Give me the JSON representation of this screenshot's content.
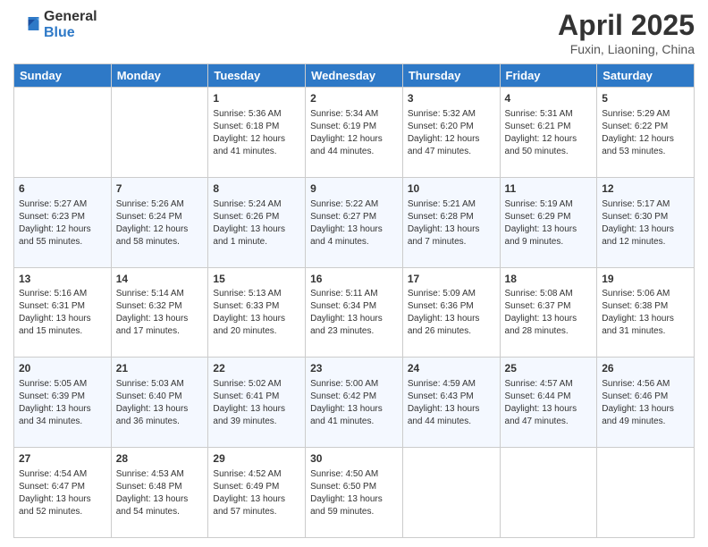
{
  "header": {
    "logo_line1": "General",
    "logo_line2": "Blue",
    "month_title": "April 2025",
    "subtitle": "Fuxin, Liaoning, China"
  },
  "days_of_week": [
    "Sunday",
    "Monday",
    "Tuesday",
    "Wednesday",
    "Thursday",
    "Friday",
    "Saturday"
  ],
  "weeks": [
    [
      {
        "day": "",
        "sunrise": "",
        "sunset": "",
        "daylight": ""
      },
      {
        "day": "",
        "sunrise": "",
        "sunset": "",
        "daylight": ""
      },
      {
        "day": "1",
        "sunrise": "Sunrise: 5:36 AM",
        "sunset": "Sunset: 6:18 PM",
        "daylight": "Daylight: 12 hours and 41 minutes."
      },
      {
        "day": "2",
        "sunrise": "Sunrise: 5:34 AM",
        "sunset": "Sunset: 6:19 PM",
        "daylight": "Daylight: 12 hours and 44 minutes."
      },
      {
        "day": "3",
        "sunrise": "Sunrise: 5:32 AM",
        "sunset": "Sunset: 6:20 PM",
        "daylight": "Daylight: 12 hours and 47 minutes."
      },
      {
        "day": "4",
        "sunrise": "Sunrise: 5:31 AM",
        "sunset": "Sunset: 6:21 PM",
        "daylight": "Daylight: 12 hours and 50 minutes."
      },
      {
        "day": "5",
        "sunrise": "Sunrise: 5:29 AM",
        "sunset": "Sunset: 6:22 PM",
        "daylight": "Daylight: 12 hours and 53 minutes."
      }
    ],
    [
      {
        "day": "6",
        "sunrise": "Sunrise: 5:27 AM",
        "sunset": "Sunset: 6:23 PM",
        "daylight": "Daylight: 12 hours and 55 minutes."
      },
      {
        "day": "7",
        "sunrise": "Sunrise: 5:26 AM",
        "sunset": "Sunset: 6:24 PM",
        "daylight": "Daylight: 12 hours and 58 minutes."
      },
      {
        "day": "8",
        "sunrise": "Sunrise: 5:24 AM",
        "sunset": "Sunset: 6:26 PM",
        "daylight": "Daylight: 13 hours and 1 minute."
      },
      {
        "day": "9",
        "sunrise": "Sunrise: 5:22 AM",
        "sunset": "Sunset: 6:27 PM",
        "daylight": "Daylight: 13 hours and 4 minutes."
      },
      {
        "day": "10",
        "sunrise": "Sunrise: 5:21 AM",
        "sunset": "Sunset: 6:28 PM",
        "daylight": "Daylight: 13 hours and 7 minutes."
      },
      {
        "day": "11",
        "sunrise": "Sunrise: 5:19 AM",
        "sunset": "Sunset: 6:29 PM",
        "daylight": "Daylight: 13 hours and 9 minutes."
      },
      {
        "day": "12",
        "sunrise": "Sunrise: 5:17 AM",
        "sunset": "Sunset: 6:30 PM",
        "daylight": "Daylight: 13 hours and 12 minutes."
      }
    ],
    [
      {
        "day": "13",
        "sunrise": "Sunrise: 5:16 AM",
        "sunset": "Sunset: 6:31 PM",
        "daylight": "Daylight: 13 hours and 15 minutes."
      },
      {
        "day": "14",
        "sunrise": "Sunrise: 5:14 AM",
        "sunset": "Sunset: 6:32 PM",
        "daylight": "Daylight: 13 hours and 17 minutes."
      },
      {
        "day": "15",
        "sunrise": "Sunrise: 5:13 AM",
        "sunset": "Sunset: 6:33 PM",
        "daylight": "Daylight: 13 hours and 20 minutes."
      },
      {
        "day": "16",
        "sunrise": "Sunrise: 5:11 AM",
        "sunset": "Sunset: 6:34 PM",
        "daylight": "Daylight: 13 hours and 23 minutes."
      },
      {
        "day": "17",
        "sunrise": "Sunrise: 5:09 AM",
        "sunset": "Sunset: 6:36 PM",
        "daylight": "Daylight: 13 hours and 26 minutes."
      },
      {
        "day": "18",
        "sunrise": "Sunrise: 5:08 AM",
        "sunset": "Sunset: 6:37 PM",
        "daylight": "Daylight: 13 hours and 28 minutes."
      },
      {
        "day": "19",
        "sunrise": "Sunrise: 5:06 AM",
        "sunset": "Sunset: 6:38 PM",
        "daylight": "Daylight: 13 hours and 31 minutes."
      }
    ],
    [
      {
        "day": "20",
        "sunrise": "Sunrise: 5:05 AM",
        "sunset": "Sunset: 6:39 PM",
        "daylight": "Daylight: 13 hours and 34 minutes."
      },
      {
        "day": "21",
        "sunrise": "Sunrise: 5:03 AM",
        "sunset": "Sunset: 6:40 PM",
        "daylight": "Daylight: 13 hours and 36 minutes."
      },
      {
        "day": "22",
        "sunrise": "Sunrise: 5:02 AM",
        "sunset": "Sunset: 6:41 PM",
        "daylight": "Daylight: 13 hours and 39 minutes."
      },
      {
        "day": "23",
        "sunrise": "Sunrise: 5:00 AM",
        "sunset": "Sunset: 6:42 PM",
        "daylight": "Daylight: 13 hours and 41 minutes."
      },
      {
        "day": "24",
        "sunrise": "Sunrise: 4:59 AM",
        "sunset": "Sunset: 6:43 PM",
        "daylight": "Daylight: 13 hours and 44 minutes."
      },
      {
        "day": "25",
        "sunrise": "Sunrise: 4:57 AM",
        "sunset": "Sunset: 6:44 PM",
        "daylight": "Daylight: 13 hours and 47 minutes."
      },
      {
        "day": "26",
        "sunrise": "Sunrise: 4:56 AM",
        "sunset": "Sunset: 6:46 PM",
        "daylight": "Daylight: 13 hours and 49 minutes."
      }
    ],
    [
      {
        "day": "27",
        "sunrise": "Sunrise: 4:54 AM",
        "sunset": "Sunset: 6:47 PM",
        "daylight": "Daylight: 13 hours and 52 minutes."
      },
      {
        "day": "28",
        "sunrise": "Sunrise: 4:53 AM",
        "sunset": "Sunset: 6:48 PM",
        "daylight": "Daylight: 13 hours and 54 minutes."
      },
      {
        "day": "29",
        "sunrise": "Sunrise: 4:52 AM",
        "sunset": "Sunset: 6:49 PM",
        "daylight": "Daylight: 13 hours and 57 minutes."
      },
      {
        "day": "30",
        "sunrise": "Sunrise: 4:50 AM",
        "sunset": "Sunset: 6:50 PM",
        "daylight": "Daylight: 13 hours and 59 minutes."
      },
      {
        "day": "",
        "sunrise": "",
        "sunset": "",
        "daylight": ""
      },
      {
        "day": "",
        "sunrise": "",
        "sunset": "",
        "daylight": ""
      },
      {
        "day": "",
        "sunrise": "",
        "sunset": "",
        "daylight": ""
      }
    ]
  ]
}
